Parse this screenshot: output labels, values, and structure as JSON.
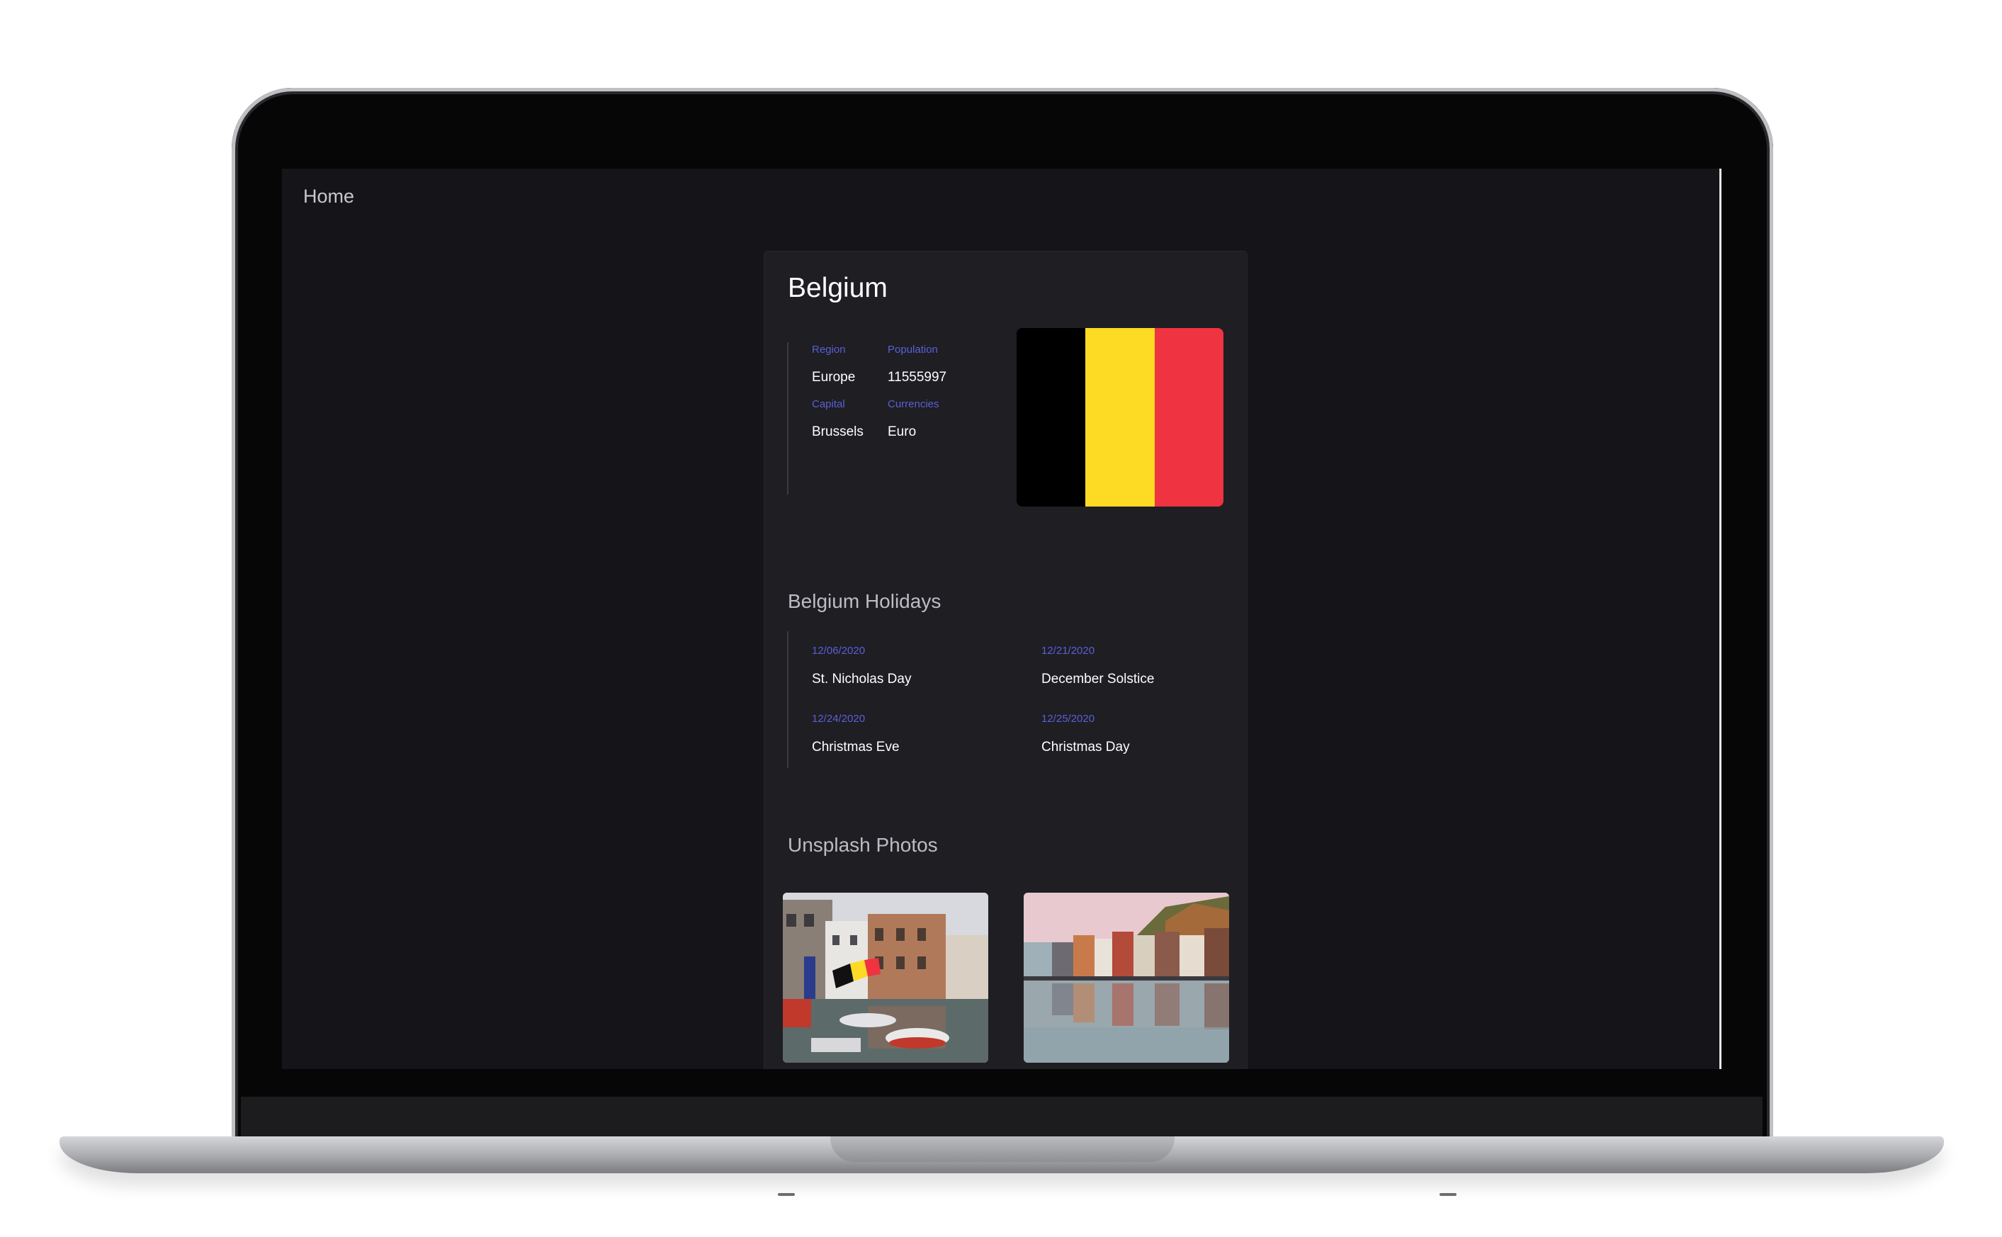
{
  "nav": {
    "home_label": "Home"
  },
  "country": {
    "name": "Belgium",
    "fields": {
      "region_label": "Region",
      "region_value": "Europe",
      "population_label": "Population",
      "population_value": "11555997",
      "capital_label": "Capital",
      "capital_value": "Brussels",
      "currencies_label": "Currencies",
      "currencies_value": "Euro"
    },
    "flag_colors": [
      "#000000",
      "#fdda24",
      "#ef3340"
    ]
  },
  "holidays": {
    "title": "Belgium Holidays",
    "items": [
      {
        "date": "12/06/2020",
        "name": "St. Nicholas Day"
      },
      {
        "date": "12/21/2020",
        "name": "December Solstice"
      },
      {
        "date": "12/24/2020",
        "name": "Christmas Eve"
      },
      {
        "date": "12/25/2020",
        "name": "Christmas Day"
      }
    ]
  },
  "photos": {
    "title": "Unsplash Photos"
  },
  "colors": {
    "accent": "#5b5fd6",
    "background": "#141419",
    "card": "#1e1e23"
  }
}
